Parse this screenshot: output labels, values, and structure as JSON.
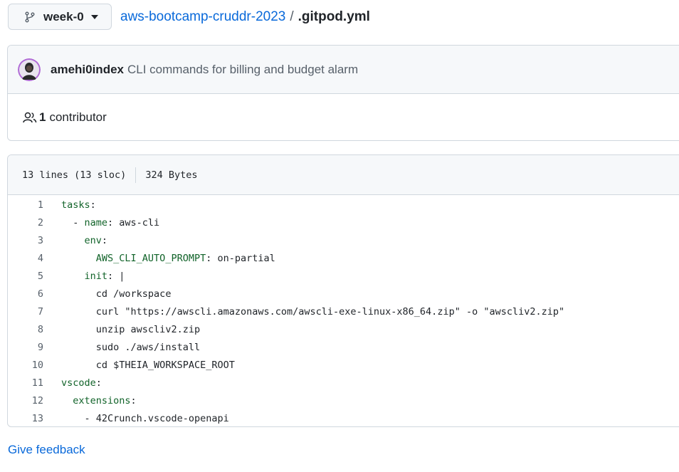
{
  "branch": {
    "icon": "git-branch-icon",
    "label": "week-0",
    "caret_icon": "triangle-down-icon"
  },
  "breadcrumb": {
    "repo": "aws-bootcamp-cruddr-2023",
    "separator": "/",
    "file": ".gitpod.yml"
  },
  "commit": {
    "avatar_icon": "user-avatar",
    "author": "amehi0index",
    "message": "CLI commands for billing and budget alarm"
  },
  "contributors": {
    "icon": "people-icon",
    "count": "1",
    "label": "contributor"
  },
  "file_info": {
    "lines": "13 lines (13 sloc)",
    "size": "324 Bytes"
  },
  "code_lines": [
    {
      "num": "1",
      "indent": "",
      "key": "tasks",
      "rest": ":"
    },
    {
      "num": "2",
      "indent": "  ",
      "prefix": "- ",
      "key": "name",
      "rest": ": aws-cli"
    },
    {
      "num": "3",
      "indent": "    ",
      "key": "env",
      "rest": ":"
    },
    {
      "num": "4",
      "indent": "      ",
      "key": "AWS_CLI_AUTO_PROMPT",
      "rest": ": on-partial"
    },
    {
      "num": "5",
      "indent": "    ",
      "key": "init",
      "rest": ": |"
    },
    {
      "num": "6",
      "indent": "      ",
      "key": "",
      "rest": "cd /workspace"
    },
    {
      "num": "7",
      "indent": "      ",
      "key": "",
      "rest": "curl \"https://awscli.amazonaws.com/awscli-exe-linux-x86_64.zip\" -o \"awscliv2.zip\""
    },
    {
      "num": "8",
      "indent": "      ",
      "key": "",
      "rest": "unzip awscliv2.zip"
    },
    {
      "num": "9",
      "indent": "      ",
      "key": "",
      "rest": "sudo ./aws/install"
    },
    {
      "num": "10",
      "indent": "      ",
      "key": "",
      "rest": "cd $THEIA_WORKSPACE_ROOT"
    },
    {
      "num": "11",
      "indent": "",
      "key": "vscode",
      "rest": ":"
    },
    {
      "num": "12",
      "indent": "  ",
      "key": "extensions",
      "rest": ":"
    },
    {
      "num": "13",
      "indent": "    ",
      "prefix": "- ",
      "key": "",
      "rest": "42Crunch.vscode-openapi"
    }
  ],
  "footer": {
    "feedback": "Give feedback"
  },
  "colors": {
    "link": "#0969da",
    "key": "#116329",
    "muted": "#57606a",
    "border": "#d0d7de",
    "header_bg": "#f6f8fa"
  }
}
